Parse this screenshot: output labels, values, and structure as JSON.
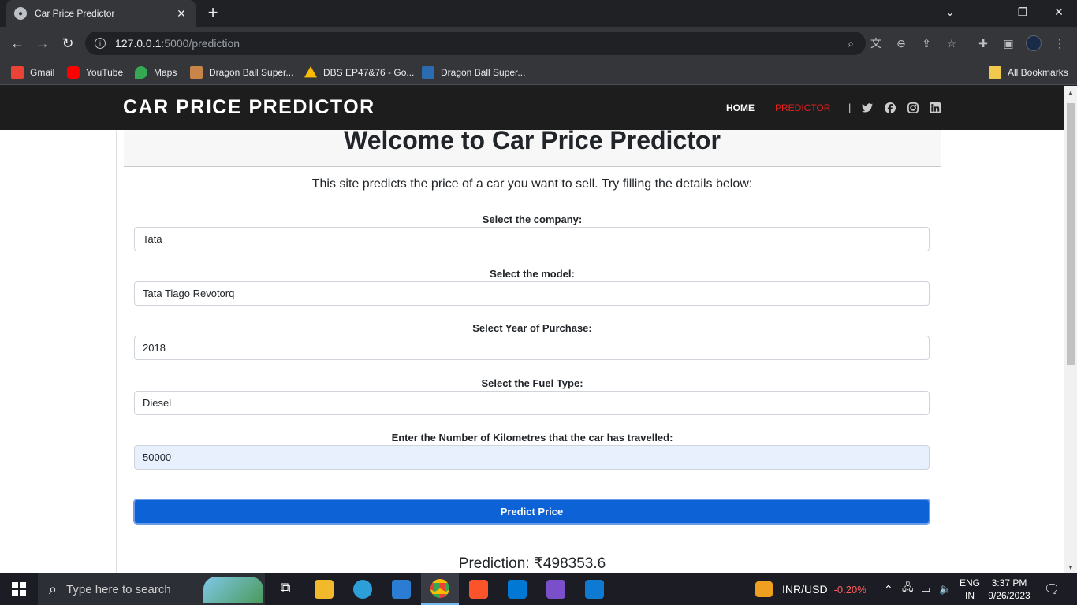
{
  "browser": {
    "tab_title": "Car Price Predictor",
    "url_host": "127.0.0.1",
    "url_path": ":5000/prediction",
    "bookmarks": [
      {
        "label": "Gmail",
        "color": "#ea4335"
      },
      {
        "label": "YouTube",
        "color": "#ff0000"
      },
      {
        "label": "Maps",
        "color": "#34a853"
      },
      {
        "label": "Dragon Ball Super...",
        "color": "#c9844a"
      },
      {
        "label": "DBS EP47&76 - Go...",
        "color": "#fbbc04"
      },
      {
        "label": "Dragon Ball Super...",
        "color": "#2b6cb0"
      }
    ],
    "all_bookmarks": "All Bookmarks"
  },
  "site": {
    "brand": "CAR PRICE PREDICTOR",
    "nav": {
      "home": "HOME",
      "predictor": "PREDICTOR",
      "sep": "|"
    },
    "nav_colors": {
      "home": "#ffffff",
      "predictor": "#e02020"
    },
    "social_icons": [
      "twitter-icon",
      "facebook-icon",
      "instagram-icon",
      "linkedin-icon"
    ]
  },
  "main": {
    "heading": "Welcome to Car Price Predictor",
    "intro": "This site predicts the price of a car you want to sell. Try filling the details below:",
    "fields": [
      {
        "label": "Select the company:",
        "value": "Tata"
      },
      {
        "label": "Select the model:",
        "value": "Tata Tiago Revotorq"
      },
      {
        "label": "Select Year of Purchase:",
        "value": "2018"
      },
      {
        "label": "Select the Fuel Type:",
        "value": "Diesel"
      },
      {
        "label": "Enter the Number of Kilometres that the car has travelled:",
        "value": "50000"
      }
    ],
    "button": "Predict Price",
    "prediction": "Prediction: ₹498353.6"
  },
  "taskbar": {
    "search_placeholder": "Type here to search",
    "currency": "INR/USD",
    "currency_change": "-0.20%",
    "currency_change_color": "#ff5c5c",
    "lang_top": "ENG",
    "lang_bottom": "IN",
    "time": "3:37 PM",
    "date": "9/26/2023"
  }
}
